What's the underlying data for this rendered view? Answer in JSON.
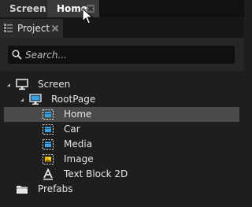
{
  "doc_tabs": [
    {
      "label": "Screen",
      "active": false
    },
    {
      "label": "Home",
      "active": true
    }
  ],
  "panel": {
    "tab_label": "Project"
  },
  "search": {
    "placeholder": "Search..."
  },
  "tree": {
    "root": {
      "label": "Screen",
      "icon": "monitor-icon",
      "expanded": true
    },
    "page": {
      "label": "RootPage",
      "icon": "page-icon",
      "expanded": true
    },
    "children": [
      {
        "label": "Home",
        "icon": "node-icon",
        "selected": true
      },
      {
        "label": "Car",
        "icon": "node-icon",
        "selected": false
      },
      {
        "label": "Media",
        "icon": "node-icon",
        "selected": false
      },
      {
        "label": "Image",
        "icon": "image-icon",
        "selected": false
      },
      {
        "label": "Text Block 2D",
        "icon": "text-block-icon",
        "selected": false
      }
    ],
    "prefabs": {
      "label": "Prefabs",
      "icon": "folder-icon"
    }
  },
  "colors": {
    "background": "#1e1e1e",
    "selection": "#4a4a4a",
    "icon_blue": "#3aa0e0",
    "icon_yellow": "#e8c000"
  }
}
